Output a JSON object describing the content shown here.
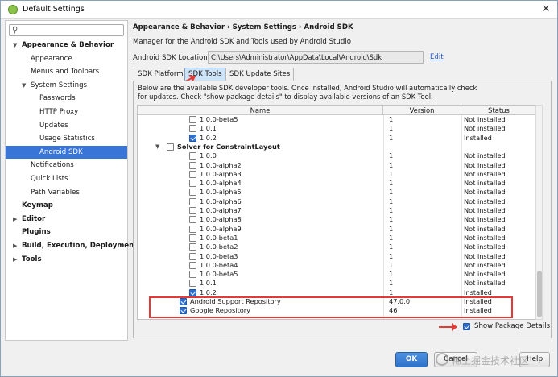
{
  "window": {
    "title": "Default Settings",
    "close_label": "✕"
  },
  "sidebar": {
    "search_placeholder": "",
    "items": [
      {
        "label": "Appearance & Behavior",
        "level": 0,
        "bold": true,
        "expanded": true
      },
      {
        "label": "Appearance",
        "level": 1
      },
      {
        "label": "Menus and Toolbars",
        "level": 1
      },
      {
        "label": "System Settings",
        "level": 1,
        "expanded": true
      },
      {
        "label": "Passwords",
        "level": 2
      },
      {
        "label": "HTTP Proxy",
        "level": 2
      },
      {
        "label": "Updates",
        "level": 2
      },
      {
        "label": "Usage Statistics",
        "level": 2
      },
      {
        "label": "Android SDK",
        "level": 2,
        "selected": true
      },
      {
        "label": "Notifications",
        "level": 1
      },
      {
        "label": "Quick Lists",
        "level": 1
      },
      {
        "label": "Path Variables",
        "level": 1
      },
      {
        "label": "Keymap",
        "level": 0,
        "bold": true
      },
      {
        "label": "Editor",
        "level": 0,
        "bold": true,
        "collapsed": true
      },
      {
        "label": "Plugins",
        "level": 0,
        "bold": true
      },
      {
        "label": "Build, Execution, Deployment",
        "level": 0,
        "bold": true,
        "collapsed": true
      },
      {
        "label": "Tools",
        "level": 0,
        "bold": true,
        "collapsed": true
      }
    ]
  },
  "main": {
    "breadcrumb": "Appearance & Behavior › System Settings › Android SDK",
    "description": "Manager for the Android SDK and Tools used by Android Studio",
    "sdk_location_label": "Android SDK Location:",
    "sdk_location_value": "C:\\Users\\Administrator\\AppData\\Local\\Android\\Sdk",
    "edit_label": "Edit",
    "tabs": [
      {
        "label": "SDK Platforms",
        "active": false
      },
      {
        "label": "SDK Tools",
        "active": true
      },
      {
        "label": "SDK Update Sites",
        "active": false
      }
    ],
    "tools_description_line1": "Below are the available SDK developer tools. Once installed, Android Studio will automatically check",
    "tools_description_line2": "for updates. Check \"show package details\" to display available versions of an SDK Tool.",
    "table": {
      "columns": [
        "Name",
        "Version",
        "Status"
      ],
      "rows": [
        {
          "indent": 3,
          "checkbox": "unchecked",
          "name": "1.0.0-beta5",
          "version": "1",
          "status": "Not installed"
        },
        {
          "indent": 3,
          "checkbox": "unchecked",
          "name": "1.0.1",
          "version": "1",
          "status": "Not installed"
        },
        {
          "indent": 3,
          "checkbox": "checked",
          "name": "1.0.2",
          "version": "1",
          "status": "Installed"
        },
        {
          "indent": 2,
          "checkbox": "partial",
          "name": "Solver for ConstraintLayout",
          "version": "",
          "status": "",
          "bold": true,
          "expander": "▼"
        },
        {
          "indent": 3,
          "checkbox": "unchecked",
          "name": "1.0.0",
          "version": "1",
          "status": "Not installed"
        },
        {
          "indent": 3,
          "checkbox": "unchecked",
          "name": "1.0.0-alpha2",
          "version": "1",
          "status": "Not installed"
        },
        {
          "indent": 3,
          "checkbox": "unchecked",
          "name": "1.0.0-alpha3",
          "version": "1",
          "status": "Not installed"
        },
        {
          "indent": 3,
          "checkbox": "unchecked",
          "name": "1.0.0-alpha4",
          "version": "1",
          "status": "Not installed"
        },
        {
          "indent": 3,
          "checkbox": "unchecked",
          "name": "1.0.0-alpha5",
          "version": "1",
          "status": "Not installed"
        },
        {
          "indent": 3,
          "checkbox": "unchecked",
          "name": "1.0.0-alpha6",
          "version": "1",
          "status": "Not installed"
        },
        {
          "indent": 3,
          "checkbox": "unchecked",
          "name": "1.0.0-alpha7",
          "version": "1",
          "status": "Not installed"
        },
        {
          "indent": 3,
          "checkbox": "unchecked",
          "name": "1.0.0-alpha8",
          "version": "1",
          "status": "Not installed"
        },
        {
          "indent": 3,
          "checkbox": "unchecked",
          "name": "1.0.0-alpha9",
          "version": "1",
          "status": "Not installed"
        },
        {
          "indent": 3,
          "checkbox": "unchecked",
          "name": "1.0.0-beta1",
          "version": "1",
          "status": "Not installed"
        },
        {
          "indent": 3,
          "checkbox": "unchecked",
          "name": "1.0.0-beta2",
          "version": "1",
          "status": "Not installed"
        },
        {
          "indent": 3,
          "checkbox": "unchecked",
          "name": "1.0.0-beta3",
          "version": "1",
          "status": "Not installed"
        },
        {
          "indent": 3,
          "checkbox": "unchecked",
          "name": "1.0.0-beta4",
          "version": "1",
          "status": "Not installed"
        },
        {
          "indent": 3,
          "checkbox": "unchecked",
          "name": "1.0.0-beta5",
          "version": "1",
          "status": "Not installed"
        },
        {
          "indent": 3,
          "checkbox": "unchecked",
          "name": "1.0.1",
          "version": "1",
          "status": "Not installed"
        },
        {
          "indent": 3,
          "checkbox": "checked",
          "name": "1.0.2",
          "version": "1",
          "status": "Installed"
        },
        {
          "indent": 1,
          "checkbox": "checked",
          "name": "Android Support Repository",
          "version": "47.0.0",
          "status": "Installed"
        },
        {
          "indent": 1,
          "checkbox": "checked",
          "name": "Google Repository",
          "version": "46",
          "status": "Installed"
        }
      ]
    },
    "show_package_details_label": "Show Package Details",
    "show_package_details_checked": true
  },
  "buttons": {
    "ok": "OK",
    "cancel": "Cancel",
    "help": "Help"
  },
  "watermark": "稀土掘金技术社区",
  "colors": {
    "selection": "#3875d7",
    "accent_blue": "#2f6fd1",
    "annotation_red": "#e53935"
  }
}
